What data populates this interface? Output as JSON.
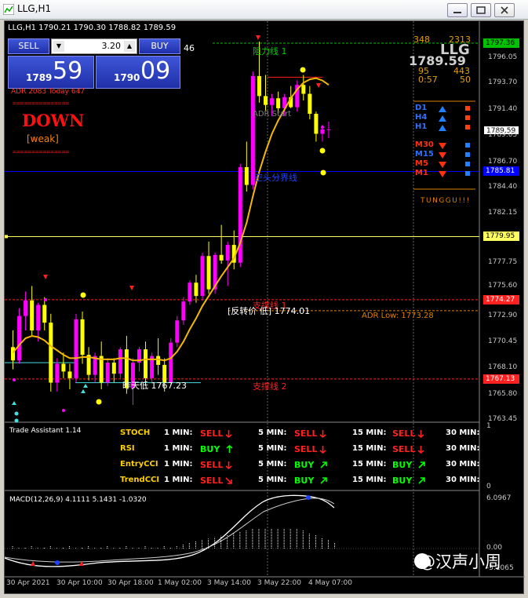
{
  "window": {
    "title": "LLG,H1"
  },
  "header": {
    "symbol_line": "LLG,H1  1790.21 1790.30 1788.82 1789.59",
    "number_46": "46"
  },
  "trade_panel": {
    "sell_label": "SELL",
    "buy_label": "BUY",
    "lot_value": "3.20",
    "sell_big": "1789",
    "sell_small": "59",
    "buy_big": "1790",
    "buy_small": "09",
    "adr_text": "ADR 2083   Today 647"
  },
  "signal": {
    "direction": "DOWN",
    "strength": "[weak]",
    "dashes": "==============="
  },
  "right_info": {
    "n348": "348",
    "n2313": "2313",
    "symbol": "LLG",
    "price": "1789.59",
    "n95": "95",
    "n443": "443",
    "time": "0:57",
    "n50": "50",
    "tf_up": [
      "D1",
      "H4",
      "H1"
    ],
    "tf_down": [
      "M30",
      "M15",
      "M5",
      "M1"
    ],
    "tunggu": "TUNGGU!!!"
  },
  "chart_labels": {
    "resistance1": "阻力线 1",
    "adr_start": "ADR Start",
    "watershed": "空头分界线",
    "reversal": "[反转价 低] 1774.01",
    "support1": "支撑线 1",
    "adr_low": "ADR Low: 1773.28",
    "yesterday_low": "昨天低 1767.23",
    "support2": "支撑线 2"
  },
  "price_scale": [
    "1797.36",
    "1796.05",
    "1793.70",
    "1791.40",
    "1789.59",
    "1789.05",
    "1786.70",
    "1785.81",
    "1784.40",
    "1782.15",
    "1779.95",
    "1777.75",
    "1775.60",
    "1774.27",
    "1772.90",
    "1770.45",
    "1768.10",
    "1767.13",
    "1765.80",
    "1763.45"
  ],
  "trade_assistant": {
    "title": "Trade Assistant 1.14",
    "timeframes": [
      "1 MIN:",
      "5 MIN:",
      "15 MIN:",
      "30 MIN:"
    ],
    "rows": [
      {
        "name": "STOCH",
        "signals": [
          "SELL",
          "SELL",
          "SELL",
          ""
        ]
      },
      {
        "name": "RSI",
        "signals": [
          "BUY",
          "SELL",
          "SELL",
          ""
        ]
      },
      {
        "name": "EntryCCI",
        "signals": [
          "SELL",
          "BUY",
          "BUY",
          ""
        ]
      },
      {
        "name": "TrendCCI",
        "signals": [
          "SELL",
          "BUY",
          "BUY",
          ""
        ]
      }
    ],
    "scale_top": "1",
    "scale_bottom": "0"
  },
  "macd": {
    "label": "MACD(12,26,9) 4.1111 5.1431 -1.0320",
    "scale_top": "6.0967",
    "scale_mid": "0.00",
    "scale_bottom": "-5.1065"
  },
  "time_axis": [
    "30 Apr 2021",
    "30 Apr 10:00",
    "30 Apr 18:00",
    "1 May 02:00",
    "3 May 14:00",
    "3 May 22:00",
    "4 May 07:00"
  ],
  "watermark": "@汉声小周",
  "colors": {
    "bull": "#ff00ff",
    "bear": "#ffff00",
    "ma": "#f5b800",
    "sell": "#ff2020",
    "buy": "#00ff00",
    "blue_line": "#0000ff"
  }
}
